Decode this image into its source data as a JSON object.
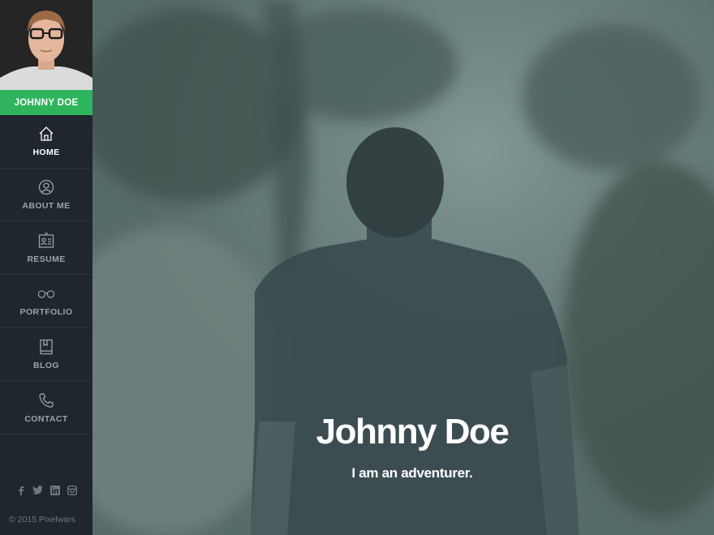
{
  "profile": {
    "name": "JOHNNY DOE"
  },
  "nav": {
    "items": [
      {
        "label": "HOME",
        "icon": "home-icon",
        "active": true
      },
      {
        "label": "ABOUT ME",
        "icon": "user-icon",
        "active": false
      },
      {
        "label": "RESUME",
        "icon": "id-card-icon",
        "active": false
      },
      {
        "label": "PORTFOLIO",
        "icon": "glasses-icon",
        "active": false
      },
      {
        "label": "BLOG",
        "icon": "book-icon",
        "active": false
      },
      {
        "label": "CONTACT",
        "icon": "phone-icon",
        "active": false
      }
    ]
  },
  "social": {
    "links": [
      {
        "icon": "facebook-icon",
        "glyph": "f"
      },
      {
        "icon": "twitter-icon",
        "glyph": "t"
      },
      {
        "icon": "linkedin-icon",
        "glyph": "in"
      },
      {
        "icon": "instagram-icon",
        "glyph": "ig"
      }
    ]
  },
  "footer": {
    "copyright": "© 2015 Pixelwars"
  },
  "hero": {
    "title": "Johnny Doe",
    "subtitle": "I am an adventurer."
  },
  "colors": {
    "accent": "#2fb45e",
    "sidebar_bg": "#1f262c",
    "nav_text": "#9aa3ab",
    "active_text": "#ffffff"
  }
}
